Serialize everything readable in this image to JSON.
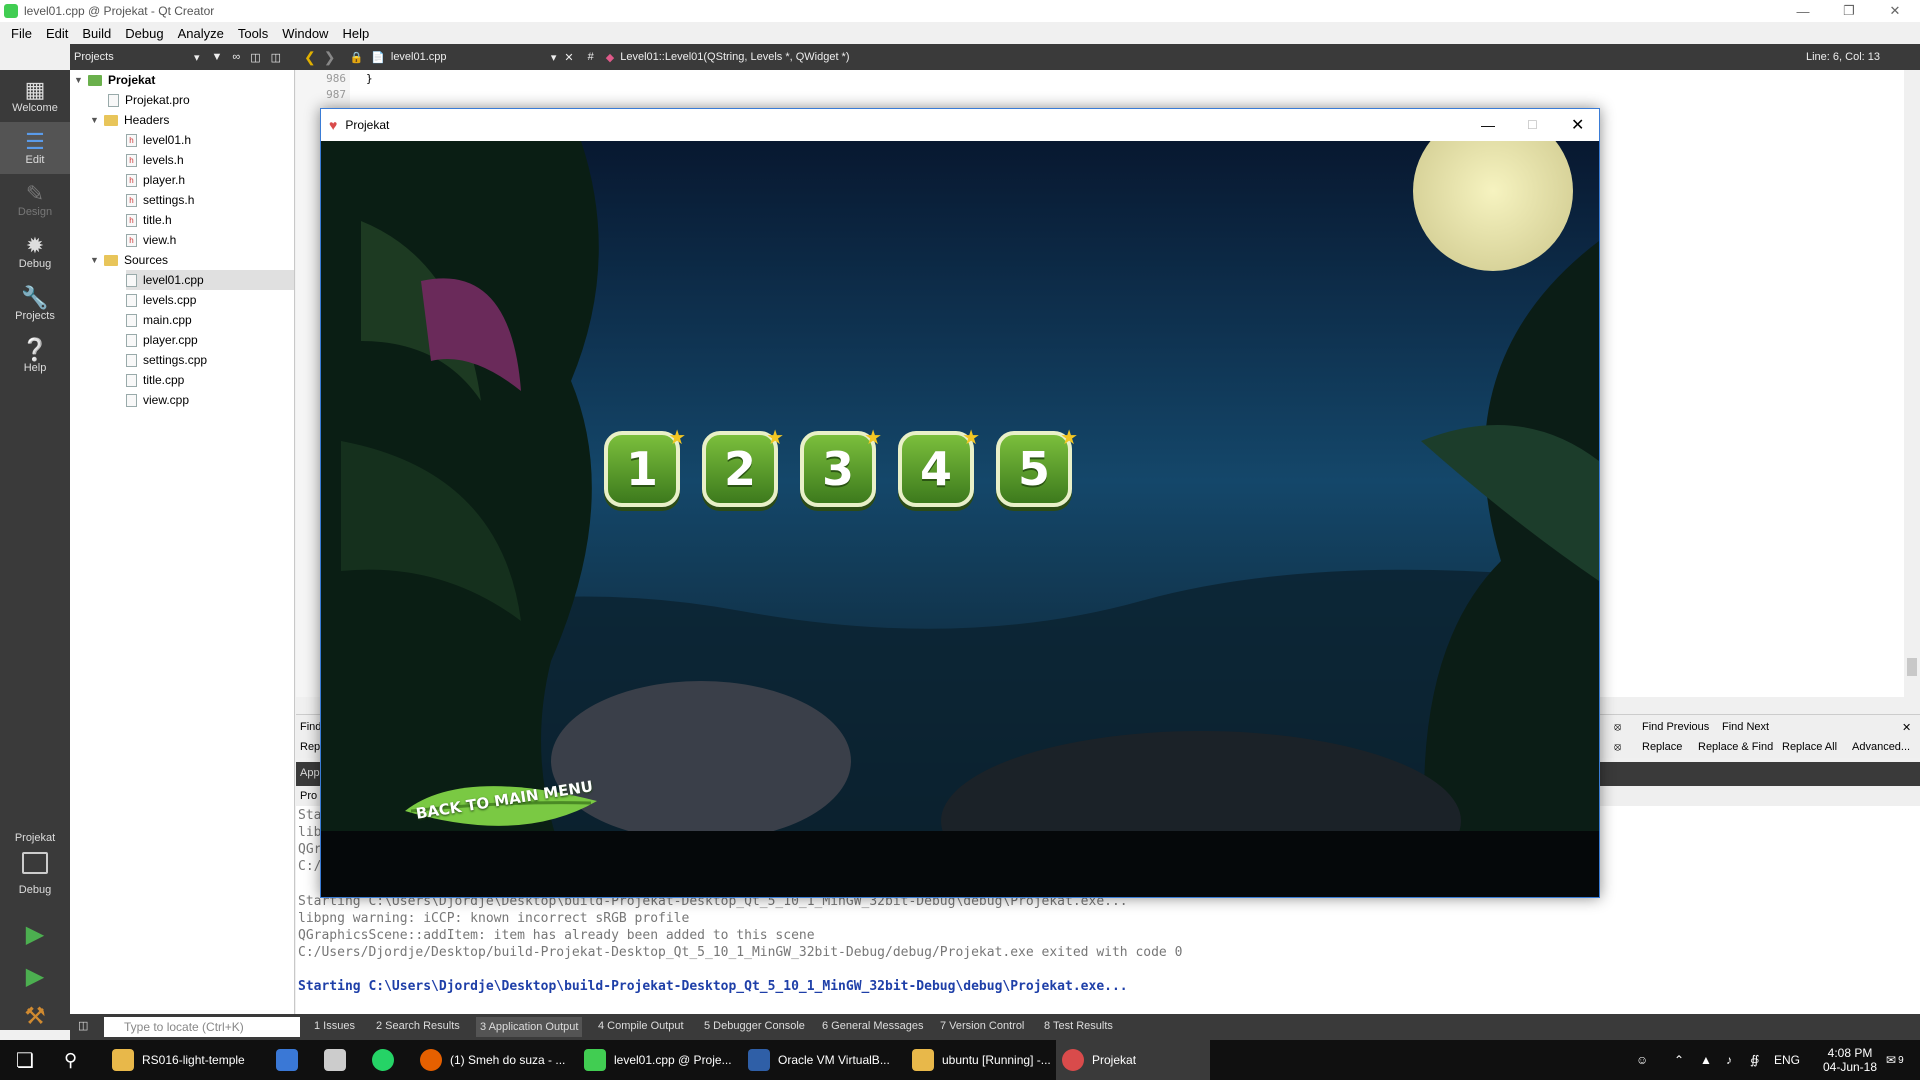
{
  "window": {
    "title": "level01.cpp @ Projekat - Qt Creator"
  },
  "menu": [
    "File",
    "Edit",
    "Build",
    "Debug",
    "Analyze",
    "Tools",
    "Window",
    "Help"
  ],
  "modes": [
    {
      "label": "Welcome",
      "icon": "grid-icon"
    },
    {
      "label": "Edit",
      "icon": "edit-icon"
    },
    {
      "label": "Design",
      "icon": "pen-icon"
    },
    {
      "label": "Debug",
      "icon": "bug-icon"
    },
    {
      "label": "Projects",
      "icon": "wrench-icon"
    },
    {
      "label": "Help",
      "icon": "help-icon"
    }
  ],
  "kit": {
    "project": "Projekat",
    "config": "Debug"
  },
  "projects_panel": {
    "label": "Projects"
  },
  "editor_toolbar": {
    "file": "level01.cpp",
    "hash": "#",
    "symbol": "Level01::Level01(QString, Levels *, QWidget *)",
    "position": "Line: 6, Col: 13"
  },
  "tree": {
    "root": "Projekat",
    "pro": "Projekat.pro",
    "headers_label": "Headers",
    "headers": [
      "level01.h",
      "levels.h",
      "player.h",
      "settings.h",
      "title.h",
      "view.h"
    ],
    "sources_label": "Sources",
    "sources": [
      "level01.cpp",
      "levels.cpp",
      "main.cpp",
      "player.cpp",
      "settings.cpp",
      "title.cpp",
      "view.cpp"
    ]
  },
  "code": {
    "lines": [
      {
        "num": "986",
        "text": "}"
      },
      {
        "num": "987",
        "text": ""
      }
    ]
  },
  "findbar": {
    "find_label": "Find",
    "replace_label": "Rep",
    "find_previous": "Find Previous",
    "find_next": "Find Next",
    "replace": "Replace",
    "replace_find": "Replace & Find",
    "replace_all": "Replace All",
    "advanced": "Advanced..."
  },
  "output": {
    "header_label": "App",
    "subheader": "Pro",
    "partial_lines": [
      "Sta",
      "lib",
      "QGr",
      "C:/"
    ],
    "lines": [
      {
        "text": "Starting C:\\Users\\Djordje\\Desktop\\build-Projekat-Desktop_Qt_5_10_1_MinGW_32bit-Debug\\debug\\Projekat.exe...",
        "style": "gray"
      },
      {
        "text": "libpng warning: iCCP: known incorrect sRGB profile",
        "style": "gray"
      },
      {
        "text": "QGraphicsScene::addItem: item has already been added to this scene",
        "style": "gray"
      },
      {
        "text": "C:/Users/Djordje/Desktop/build-Projekat-Desktop_Qt_5_10_1_MinGW_32bit-Debug/debug/Projekat.exe exited with code 0",
        "style": "gray"
      },
      {
        "text": "",
        "style": "gray"
      },
      {
        "text": "Starting C:\\Users\\Djordje\\Desktop\\build-Projekat-Desktop_Qt_5_10_1_MinGW_32bit-Debug\\debug\\Projekat.exe...",
        "style": "blue"
      }
    ]
  },
  "bottom_tabs": {
    "locate_placeholder": "Type to locate (Ctrl+K)",
    "tabs": [
      "1  Issues",
      "2  Search Results",
      "3  Application Output",
      "4  Compile Output",
      "5  Debugger Console",
      "6  General Messages",
      "7  Version Control",
      "8  Test Results"
    ]
  },
  "game": {
    "title": "Projekat",
    "levels": [
      "1",
      "2",
      "3",
      "4",
      "5"
    ],
    "back_button": "BACK TO MAIN MENU"
  },
  "taskbar": {
    "items": [
      {
        "label": "RS016-light-temple",
        "color": "#e8b84a"
      },
      {
        "label": "",
        "color": "#3a78d6"
      },
      {
        "label": "",
        "color": "#cccccc"
      },
      {
        "label": "",
        "color": "#25d366"
      },
      {
        "label": "(1) Smeh do suza - ...",
        "color": "#e66000"
      },
      {
        "label": "level01.cpp @ Proje...",
        "color": "#41cd52"
      },
      {
        "label": "Oracle VM VirtualB...",
        "color": "#2f5fa7"
      },
      {
        "label": "ubuntu [Running] -...",
        "color": "#e8b84a"
      },
      {
        "label": "Projekat",
        "color": "#d94b4b"
      }
    ],
    "lang": "ENG",
    "time": "4:08 PM",
    "date": "04-Jun-18",
    "notifications": "9"
  }
}
